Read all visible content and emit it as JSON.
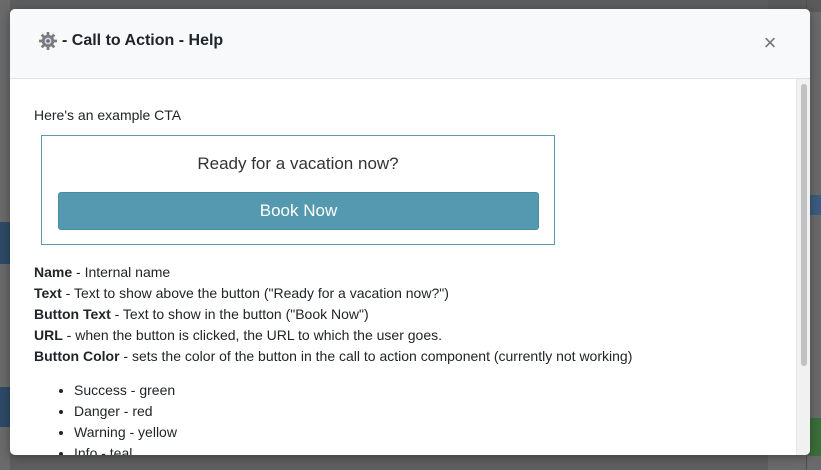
{
  "modal": {
    "title": "- Call to Action - Help",
    "close_label": "×"
  },
  "intro": "Here's an example CTA",
  "cta_example": {
    "text": "Ready for a vacation now?",
    "button_label": "Book Now",
    "button_color": "#5499af"
  },
  "fields": [
    {
      "name": "Name",
      "desc": " - Internal name"
    },
    {
      "name": "Text",
      "desc": " - Text to show above the button (\"Ready for a vacation now?\")"
    },
    {
      "name": "Button Text",
      "desc": " - Text to show in the button (\"Book Now\")"
    },
    {
      "name": "URL",
      "desc": " - when the button is clicked, the URL to which the user goes."
    },
    {
      "name": "Button Color",
      "desc": " - sets the color of the button in the call to action component (currently not working)"
    }
  ],
  "color_options": [
    "Success - green",
    "Danger - red",
    "Warning - yellow",
    "Info - teal"
  ]
}
